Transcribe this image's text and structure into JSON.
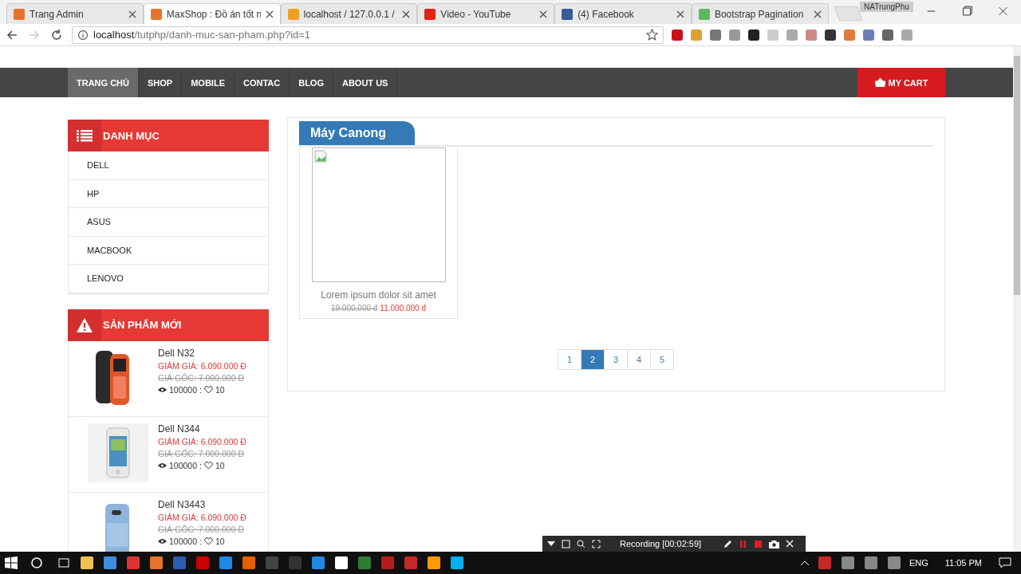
{
  "browser": {
    "tabs": [
      {
        "title": "Trang Admin",
        "selected": false
      },
      {
        "title": "MaxShop : Đồ án tốt n",
        "selected": true
      },
      {
        "title": "localhost / 127.0.0.1 /",
        "selected": false
      },
      {
        "title": "Video - YouTube",
        "selected": false
      },
      {
        "title": "(4) Facebook",
        "selected": false
      },
      {
        "title": "Bootstrap Pagination",
        "selected": false
      }
    ],
    "profile": "NATrungPhu",
    "url_host": "localhost",
    "url_path": "/tutphp/danh-muc-san-pham.php?id=1"
  },
  "nav": {
    "items": [
      {
        "label": "TRANG CHỦ",
        "selected": true
      },
      {
        "label": "SHOP",
        "selected": false
      },
      {
        "label": "MOBILE",
        "selected": false
      },
      {
        "label": "CONTAC",
        "selected": false
      },
      {
        "label": "BLOG",
        "selected": false
      },
      {
        "label": "ABOUT US",
        "selected": false
      }
    ],
    "cart": "MY CART"
  },
  "categories": {
    "title": "DANH MỤC",
    "items": [
      "DELL",
      "HP",
      "ASUS",
      "MACBOOK",
      "LENOVO"
    ]
  },
  "new_products": {
    "title": "SẢN PHẨM MỚI",
    "items": [
      {
        "name": "Dell N32",
        "sale": "GIẢM GIÁ: 6.090.000 Đ",
        "original": "GIÁ GỐC: 7.000.000 Đ",
        "views": "100000 :",
        "likes": "10",
        "kind": "feature"
      },
      {
        "name": "Dell N344",
        "sale": "GIẢM GIÁ: 6.090.000 Đ",
        "original": "GIÁ GỐC: 7.000.000 Đ",
        "views": "100000 :",
        "likes": "10",
        "kind": "smart"
      },
      {
        "name": "Dell N3443",
        "sale": "GIẢM GIÁ: 6.090.000 Đ",
        "original": "GIÁ GỐC: 7.000.000 Đ",
        "views": "100000 :",
        "likes": "10",
        "kind": "back"
      }
    ]
  },
  "section": {
    "title": "Máy Canong",
    "products": [
      {
        "name": "Lorem ipsum dolor sit amet",
        "old_price": "19.000.000 đ",
        "price": "11.000.000 đ"
      }
    ],
    "pages": [
      {
        "label": "1",
        "selected": false
      },
      {
        "label": "2",
        "selected": true
      },
      {
        "label": "3",
        "selected": false
      },
      {
        "label": "4",
        "selected": false
      },
      {
        "label": "5",
        "selected": false
      }
    ]
  },
  "recorder": {
    "status": "Recording [00:02:59]"
  },
  "taskbar": {
    "language": "ENG",
    "time": "11:05 PM"
  }
}
